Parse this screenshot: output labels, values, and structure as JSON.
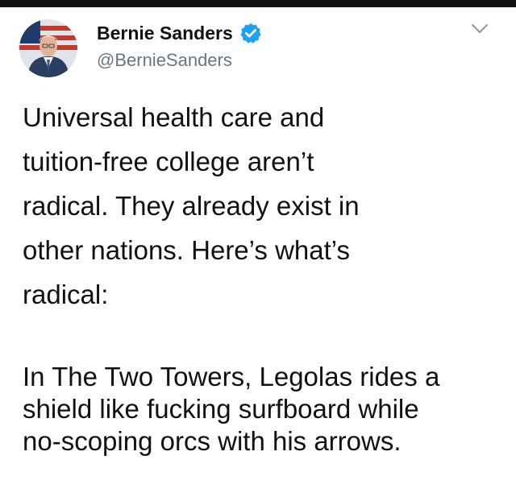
{
  "colors": {
    "background": "#ffffff",
    "text": "#111111",
    "handle": "#657786",
    "verified": "#1da1f2"
  },
  "header": {
    "avatar_icon": "profile-photo-avatar",
    "name": "Bernie Sanders",
    "verified_icon": "verified-badge-icon",
    "handle": "@BernieSanders",
    "menu_icon": "chevron-down-icon"
  },
  "tweet": {
    "paragraph1": "Universal health care and\ntuition-free college aren’t\nradical. They already exist in\nother nations. Here’s what’s\nradical:",
    "paragraph2": "In The Two Towers, Legolas rides a\nshield like fucking surfboard while\nno-scoping orcs with his arrows."
  }
}
